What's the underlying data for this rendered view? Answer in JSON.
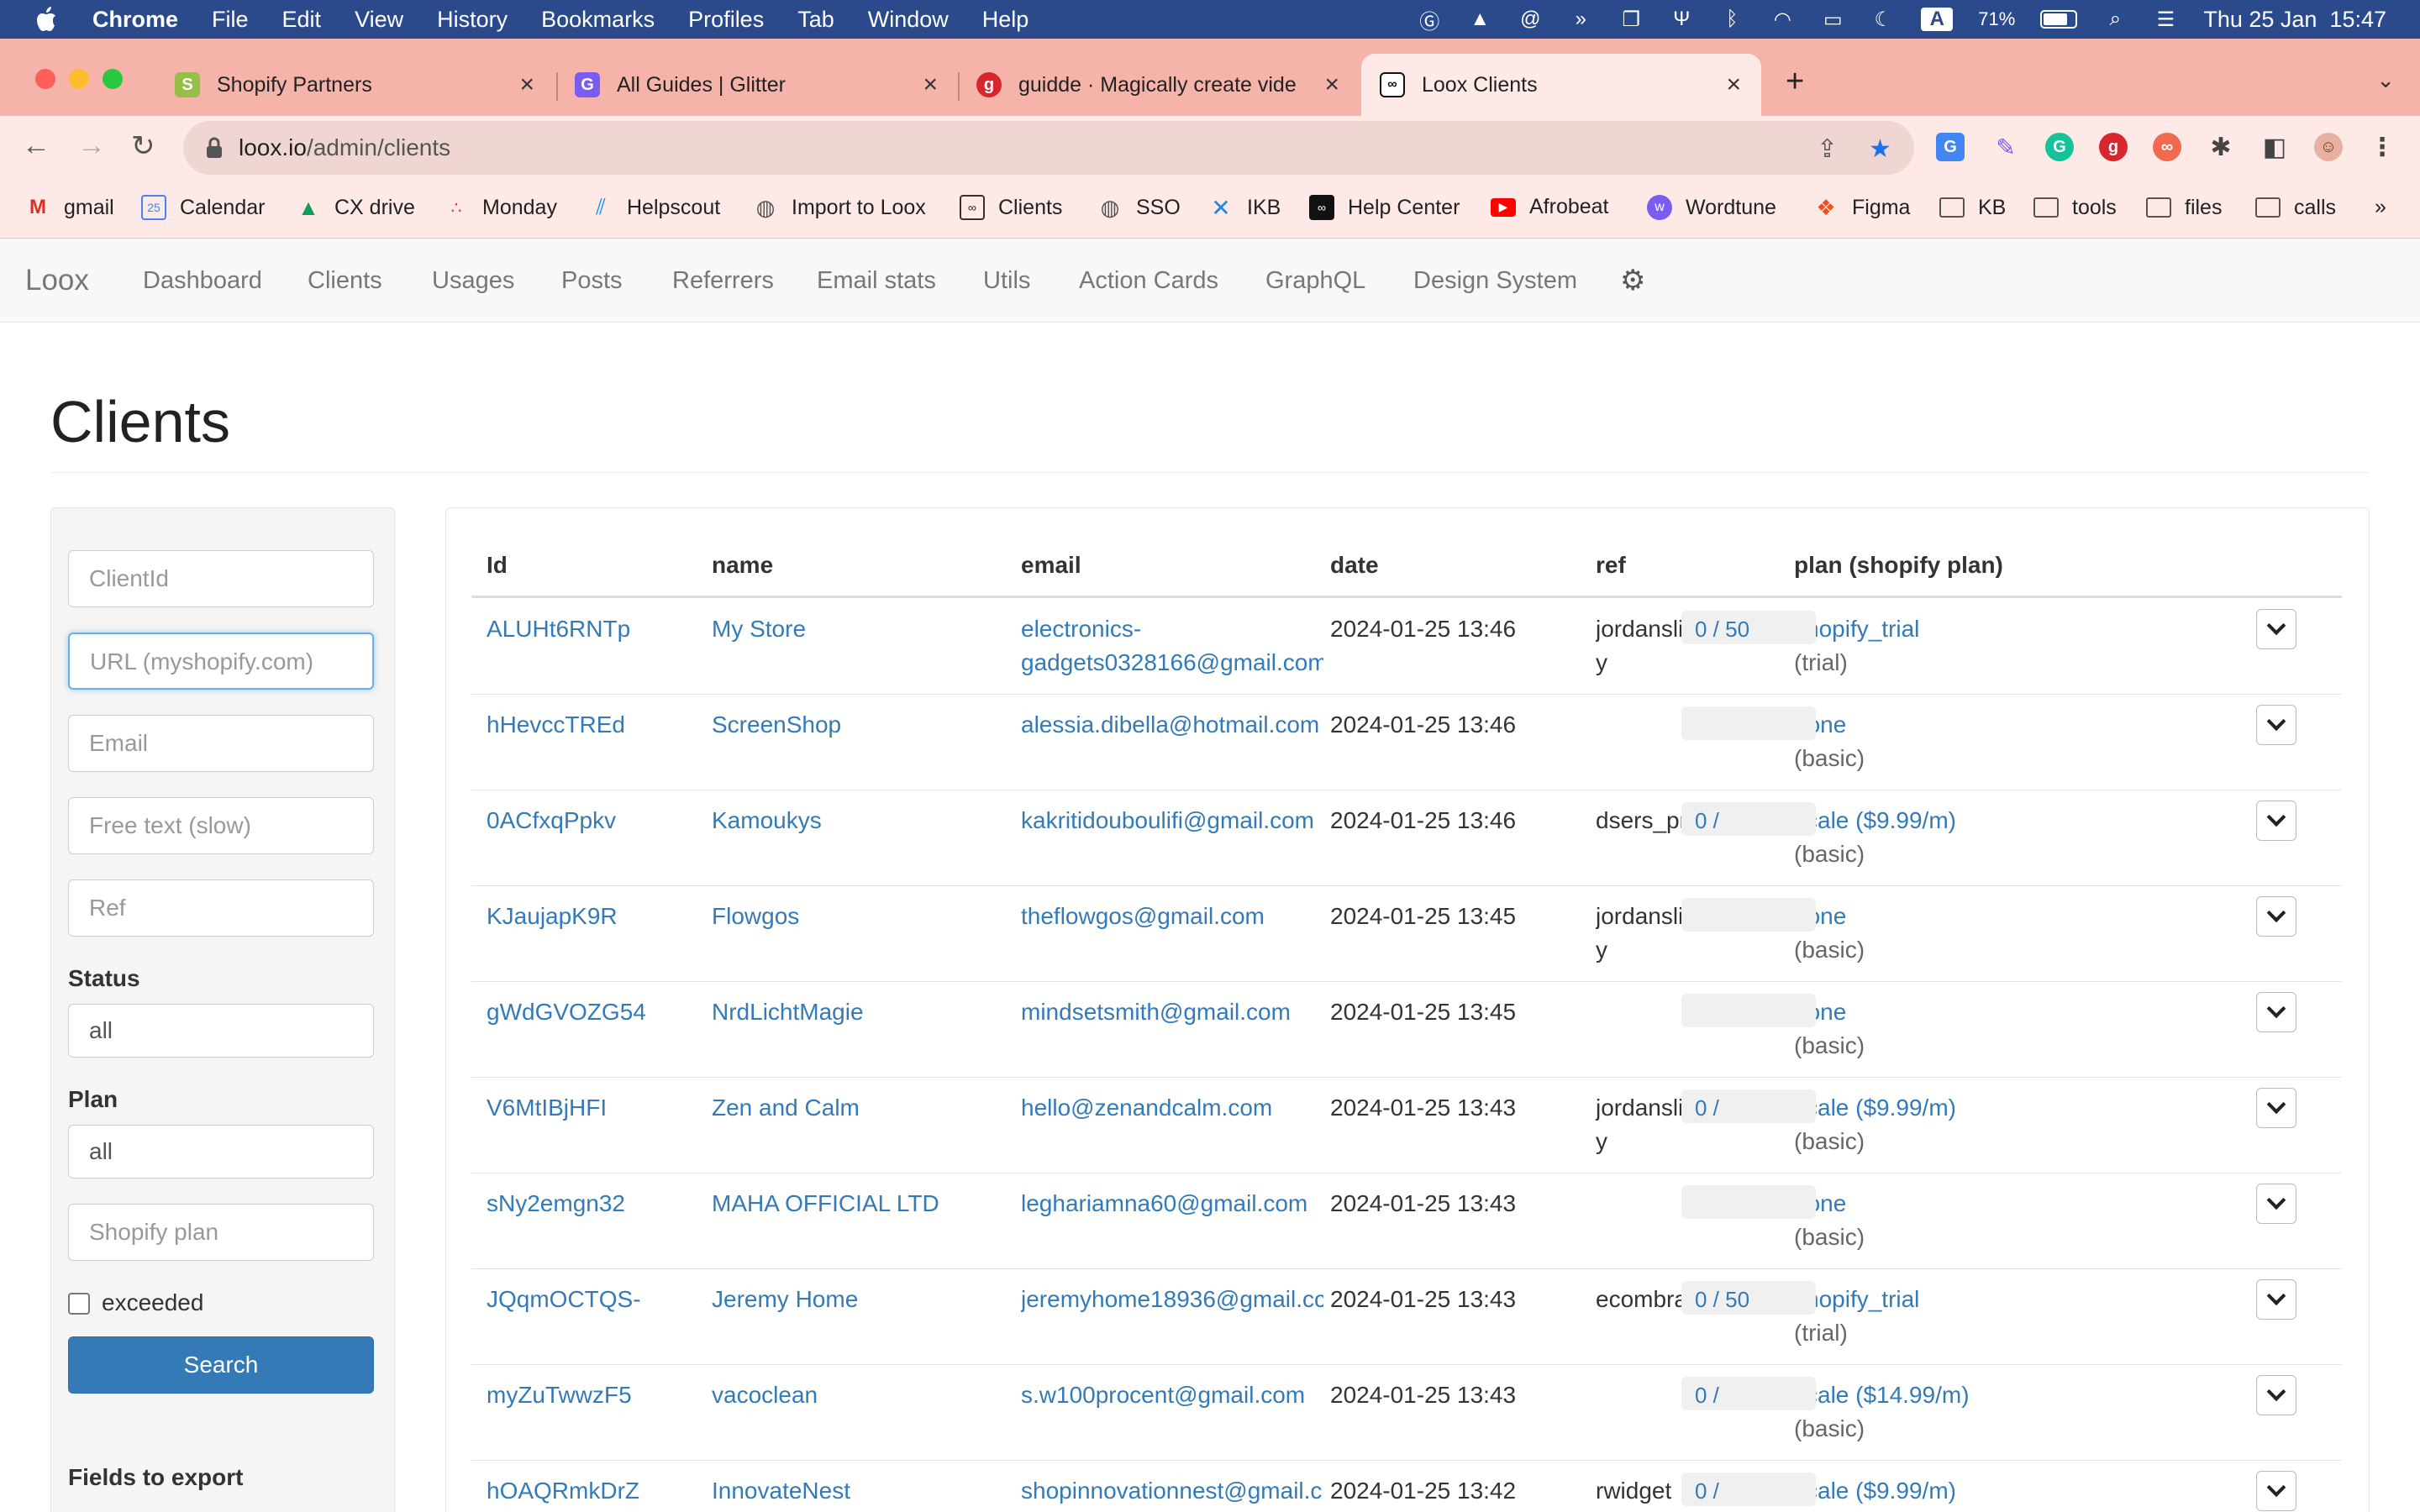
{
  "menubar": {
    "app": "Chrome",
    "items": [
      "File",
      "Edit",
      "View",
      "History",
      "Bookmarks",
      "Profiles",
      "Tab",
      "Window",
      "Help"
    ],
    "battery": "71%",
    "clock": "Thu 25 Jan  15:47",
    "input_source": "A"
  },
  "tabs": [
    {
      "title": "Shopify Partners",
      "icon": "shopify-icon"
    },
    {
      "title": "All Guides | Glitter",
      "icon": "glitter-icon"
    },
    {
      "title": "guidde · Magically create vide",
      "icon": "guidde-icon"
    },
    {
      "title": "Loox Clients",
      "icon": "loox-icon"
    }
  ],
  "address": {
    "host": "loox.io",
    "path": "/admin/clients"
  },
  "bookmarks": [
    {
      "label": "gmail",
      "icon": "gmail-icon"
    },
    {
      "label": "Calendar",
      "icon": "calendar-icon"
    },
    {
      "label": "CX drive",
      "icon": "drive-icon"
    },
    {
      "label": "Monday",
      "icon": "monday-icon"
    },
    {
      "label": "Helpscout",
      "icon": "helpscout-icon"
    },
    {
      "label": "Import to Loox",
      "icon": "globe-icon"
    },
    {
      "label": "Clients",
      "icon": "loox-icon"
    },
    {
      "label": "SSO",
      "icon": "globe-icon"
    },
    {
      "label": "IKB",
      "icon": "ikb-icon"
    },
    {
      "label": "Help Center",
      "icon": "loox-icon"
    },
    {
      "label": "Afrobeat",
      "icon": "youtube-icon"
    },
    {
      "label": "Wordtune",
      "icon": "wordtune-icon"
    },
    {
      "label": "Figma",
      "icon": "figma-icon"
    },
    {
      "label": "KB",
      "icon": "folder-icon"
    },
    {
      "label": "tools",
      "icon": "folder-icon"
    },
    {
      "label": "files",
      "icon": "folder-icon"
    },
    {
      "label": "calls",
      "icon": "folder-icon"
    }
  ],
  "bookmarks_overflow": "»",
  "appnav": {
    "brand": "Loox",
    "links": [
      "Dashboard",
      "Clients",
      "Usages",
      "Posts",
      "Referrers",
      "Email stats",
      "Utils",
      "Action Cards",
      "GraphQL",
      "Design System"
    ]
  },
  "page": {
    "title": "Clients"
  },
  "filters": {
    "client_id_placeholder": "ClientId",
    "url_placeholder": "URL (myshopify.com)",
    "email_placeholder": "Email",
    "free_text_placeholder": "Free text (slow)",
    "ref_placeholder": "Ref",
    "status_label": "Status",
    "status_value": "all",
    "plan_label": "Plan",
    "plan_value": "all",
    "shopify_plan_placeholder": "Shopify plan",
    "exceeded_label": "exceeded",
    "search_label": "Search",
    "export_label": "Fields to export"
  },
  "table": {
    "headers": [
      "Id",
      "name",
      "email",
      "date",
      "ref",
      "plan (shopify plan)"
    ],
    "rows": [
      {
        "id": "ALUHt6RNTp",
        "name": "My Store",
        "email1": "electronics-",
        "email2": "gadgets0328166@gmail.com",
        "date": "2024-01-25 13:46",
        "ref1": "jordanslibrar",
        "ref2": "y",
        "plan": "shopify_trial",
        "shopify_plan": "(trial)",
        "usage": "0 / 50"
      },
      {
        "id": "hHevccTREd",
        "name": "ScreenShop",
        "email1": "alessia.dibella@hotmail.com",
        "email2": "",
        "date": "2024-01-25 13:46",
        "ref1": "",
        "ref2": "",
        "plan": "none",
        "shopify_plan": "(basic)",
        "usage": ""
      },
      {
        "id": "0ACfxqPpkv",
        "name": "Kamoukys",
        "email1": "kakritidouboulifi@gmail.com",
        "email2": "",
        "date": "2024-01-25 13:46",
        "ref1": "dsers_pro",
        "ref2": "",
        "plan": "scale ($9.99/m)",
        "shopify_plan": "(basic)",
        "usage": "0 /"
      },
      {
        "id": "KJaujapK9R",
        "name": "Flowgos",
        "email1": "theflowgos@gmail.com",
        "email2": "",
        "date": "2024-01-25 13:45",
        "ref1": "jordanslibrar",
        "ref2": "y",
        "plan": "none",
        "shopify_plan": "(basic)",
        "usage": ""
      },
      {
        "id": "gWdGVOZG54",
        "name": "NrdLichtMagie",
        "email1": "mindsetsmith@gmail.com",
        "email2": "",
        "date": "2024-01-25 13:45",
        "ref1": "",
        "ref2": "",
        "plan": "none",
        "shopify_plan": "(basic)",
        "usage": ""
      },
      {
        "id": "V6MtIBjHFI",
        "name": "Zen and Calm",
        "email1": "hello@zenandcalm.com",
        "email2": "",
        "date": "2024-01-25 13:43",
        "ref1": "jordanslibrar",
        "ref2": "y",
        "plan": "scale ($9.99/m)",
        "shopify_plan": "(basic)",
        "usage": "0 /"
      },
      {
        "id": "sNy2emgn32",
        "name": "MAHA OFFICIAL LTD",
        "email1": "leghariamna60@gmail.com",
        "email2": "",
        "date": "2024-01-25 13:43",
        "ref1": "",
        "ref2": "",
        "plan": "none",
        "shopify_plan": "(basic)",
        "usage": ""
      },
      {
        "id": "JQqmOCTQS-",
        "name": "Jeremy Home",
        "email1": "jeremyhome18936@gmail.cc",
        "email2": "",
        "date": "2024-01-25 13:43",
        "ref1": "ecombrands",
        "ref2": "",
        "plan": "shopify_trial",
        "shopify_plan": "(trial)",
        "usage": "0 / 50"
      },
      {
        "id": "myZuTwwzF5",
        "name": "vacoclean",
        "email1": "s.w100procent@gmail.com",
        "email2": "",
        "date": "2024-01-25 13:43",
        "ref1": "",
        "ref2": "",
        "plan": "scale ($14.99/m)",
        "shopify_plan": "(basic)",
        "usage": "0 /"
      },
      {
        "id": "hOAQRmkDrZ",
        "name": "InnovateNest",
        "email1": "shopinnovationnest@gmail.c",
        "email2": "",
        "date": "2024-01-25 13:42",
        "ref1": "rwidget",
        "ref2": "",
        "plan": "scale ($9.99/m)",
        "shopify_plan": "",
        "usage": "0 /"
      }
    ]
  }
}
